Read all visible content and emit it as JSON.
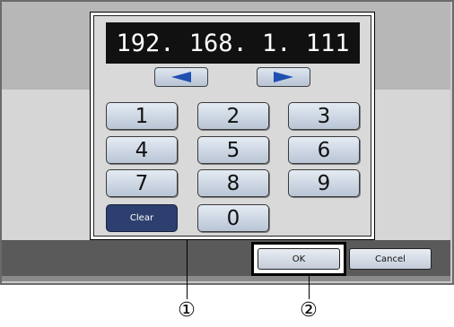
{
  "display": {
    "ip_value": "192. 168.   1. 111"
  },
  "keypad": {
    "keys": [
      "1",
      "2",
      "3",
      "4",
      "5",
      "6",
      "7",
      "8",
      "9"
    ],
    "clear_label": "Clear",
    "zero_label": "0"
  },
  "actions": {
    "ok_label": "OK",
    "cancel_label": "Cancel"
  },
  "callouts": {
    "keypad_marker": "①",
    "ok_marker": "②"
  },
  "colors": {
    "display_bg": "#111111",
    "clear_bg": "#2c3f6e",
    "frame_bg": "#c9c9c9",
    "bottom_bar": "#5a5a5a"
  }
}
